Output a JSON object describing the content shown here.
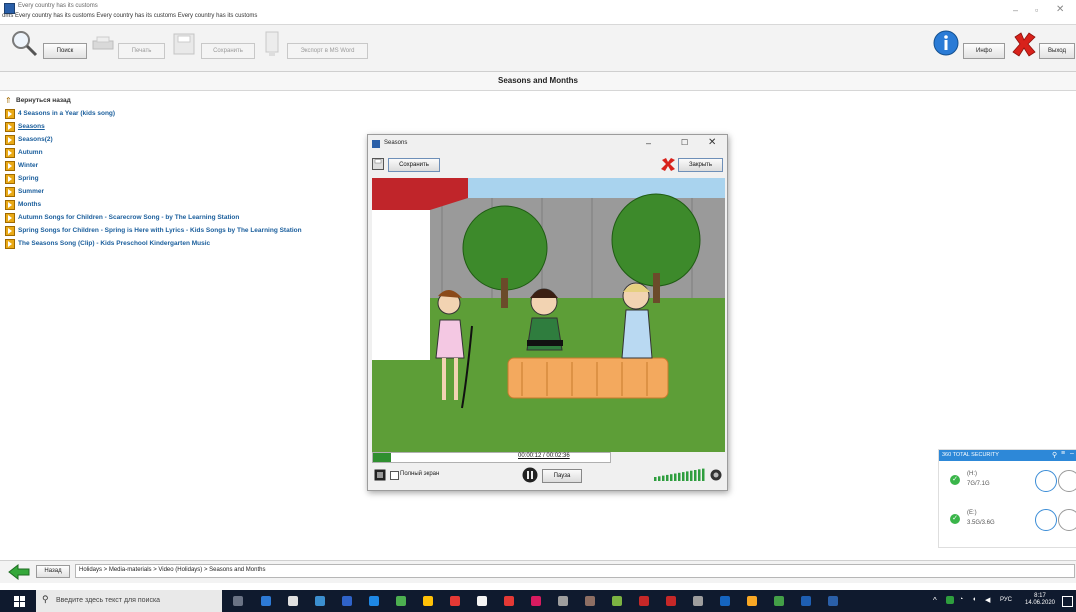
{
  "window": {
    "title": "Every country has its customs",
    "marquee": "oms   Every country has its customs   Every country has its customs   Every country has its customs"
  },
  "toolbar": {
    "search_label": "Поиск",
    "print_label": "Печать",
    "save_label": "Сохранить",
    "export_label": "Экспорт в MS Word",
    "info_label": "Инфо",
    "exit_label": "Выход"
  },
  "page": {
    "title": "Seasons and Months"
  },
  "list": {
    "back_label": "Вернуться назад",
    "items": [
      {
        "label": "4 Seasons in a Year (kids song)",
        "underline": false
      },
      {
        "label": "Seasons",
        "underline": true
      },
      {
        "label": "Seasons(2)",
        "underline": false
      },
      {
        "label": "Autumn",
        "underline": false
      },
      {
        "label": "Winter",
        "underline": false
      },
      {
        "label": "Spring",
        "underline": false
      },
      {
        "label": "Summer",
        "underline": false
      },
      {
        "label": "Months",
        "underline": false
      },
      {
        "label": "Autumn Songs for Children - Scarecrow Song - by The Learning Station",
        "underline": false
      },
      {
        "label": "Spring Songs for Children - Spring is Here with Lyrics - Kids Songs by The Learning Station",
        "underline": false
      },
      {
        "label": "The Seasons Song (Clip) - Kids Preschool Kindergarten Music",
        "underline": false
      }
    ]
  },
  "modal": {
    "title": "Seasons",
    "save_label": "Сохранить",
    "close_label": "Закрыть",
    "time": "00:00:12 / 00:02:36",
    "progress": 0.077,
    "fullscreen_label": "Полный экран",
    "pause_label": "Пауза",
    "volume_bars": 13
  },
  "security": {
    "title": "360 TOTAL SECURITY",
    "drives": [
      {
        "name": "(H:)",
        "size": "7G/7.1G"
      },
      {
        "name": "(E:)",
        "size": "3.5G/3.6G"
      }
    ]
  },
  "bottom": {
    "back_label": "Назад",
    "breadcrumb": "Holidays > Media-materials > Video (Holidays) > Seasons and Months"
  },
  "taskbar": {
    "search_placeholder": "Введите здесь текст для поиска",
    "lang": "РУС",
    "time": "8:17",
    "date": "14.06.2020"
  },
  "colors": {
    "link": "#1a5e9c",
    "accent_blue": "#2d88d8",
    "taskbar": "#0f1a2e"
  }
}
